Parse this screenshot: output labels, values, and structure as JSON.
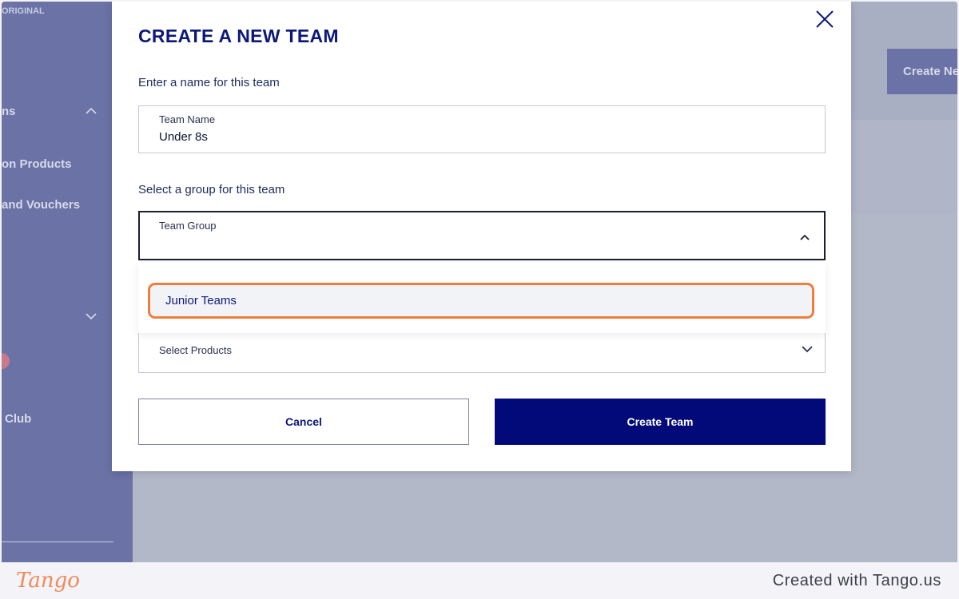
{
  "sidebar": {
    "brand": "ORIGINAL",
    "items": [
      {
        "label": "ns"
      },
      {
        "label": "on Products"
      },
      {
        "label": "and Vouchers"
      },
      {
        "label": "Club"
      }
    ]
  },
  "header": {
    "create_new_label": "Create Ne"
  },
  "modal": {
    "title": "CREATE A NEW TEAM",
    "name_prompt": "Enter a name for this team",
    "team_name": {
      "label": "Team Name",
      "value": "Under 8s"
    },
    "group_prompt": "Select a group for this team",
    "team_group": {
      "label": "Team Group",
      "value": ""
    },
    "group_options": [
      "Junior Teams"
    ],
    "products": {
      "placeholder": "Select Products"
    },
    "cancel_label": "Cancel",
    "create_label": "Create Team"
  },
  "footer": {
    "logo": "Tango",
    "created_with": "Created with Tango.us"
  },
  "colors": {
    "accent": "#010a78",
    "highlight": "#f07c3e",
    "sidebar": "#6a72a6"
  }
}
